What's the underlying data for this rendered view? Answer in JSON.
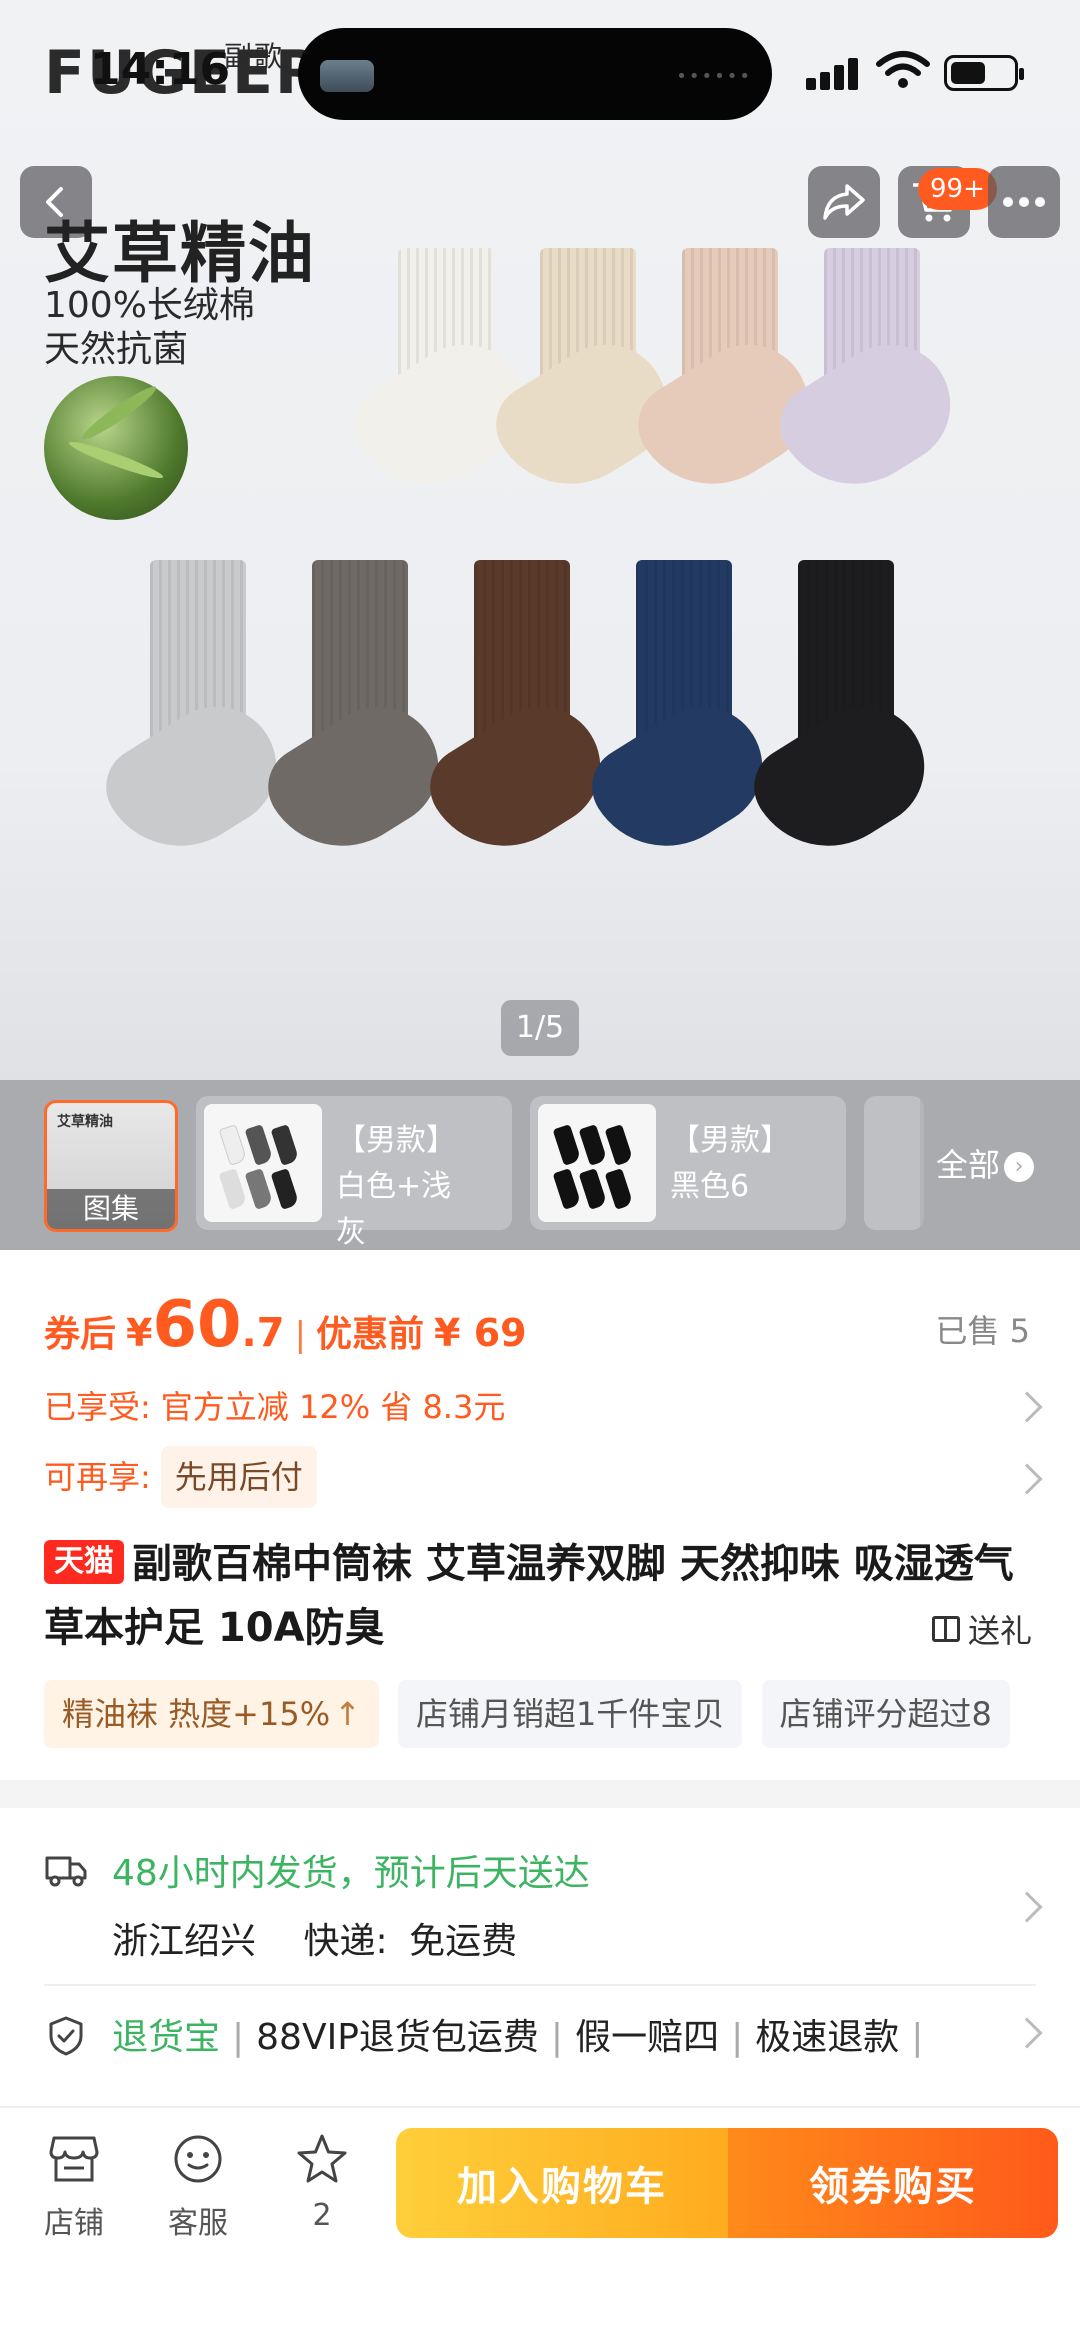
{
  "status_bar": {
    "time": "14:16"
  },
  "hero": {
    "brand_logo": "FUGEER",
    "brand_logo_cn": "副歌",
    "title": "艾草精油",
    "subtitle_lines": [
      "100%长绒棉",
      "天然抗菌"
    ],
    "cart_badge": "99+",
    "pager": "1/5",
    "sock_colors": [
      "#f2f0ea",
      "#e9dcc6",
      "#e6cbbb",
      "#d7cde0",
      "#c9cacb",
      "#6f6a66",
      "#5a3a2a",
      "#233a63",
      "#1d1d1f"
    ]
  },
  "sku_strip": {
    "first_label": "图集",
    "first_mini": "艾草精油",
    "items": [
      {
        "name": "【男款】白色+浅灰"
      },
      {
        "name": "【男款】黑色6"
      }
    ],
    "all_label": "全部"
  },
  "price": {
    "label": "券后",
    "currency": "¥",
    "integer": "60",
    "decimal": ".7",
    "separator": "|",
    "orig_label": "优惠前",
    "orig_value": "¥ 69",
    "sold": "已售 5"
  },
  "promos": {
    "enjoyed_label": "已享受:",
    "enjoyed_value": "官方立减 12% 省 8.3元",
    "more_label": "可再享:",
    "more_value": "先用后付"
  },
  "product": {
    "tmall_badge": "天猫",
    "title": "副歌百棉中筒袜 艾草温养双脚 天然抑味 吸湿透气草本护足 10A防臭",
    "gift_label": "送礼",
    "tags": [
      "精油袜 热度+15%",
      "店铺月销超1千件宝贝",
      "店铺评分超过8"
    ]
  },
  "shipping": {
    "eta": "48小时内发货，预计后天送达",
    "origin": "浙江绍兴",
    "express_label": "快递:",
    "express_value": "免运费",
    "services": [
      "退货宝",
      "88VIP退货包运费",
      "假一赔四",
      "极速退款"
    ]
  },
  "bottom_bar": {
    "store": "店铺",
    "service": "客服",
    "favorites": "2",
    "add_to_cart": "加入购物车",
    "buy": "领券购买"
  },
  "colors": {
    "accent": "#ff5a1f",
    "green": "#3cb462",
    "tmall": "#ff2a1f"
  }
}
